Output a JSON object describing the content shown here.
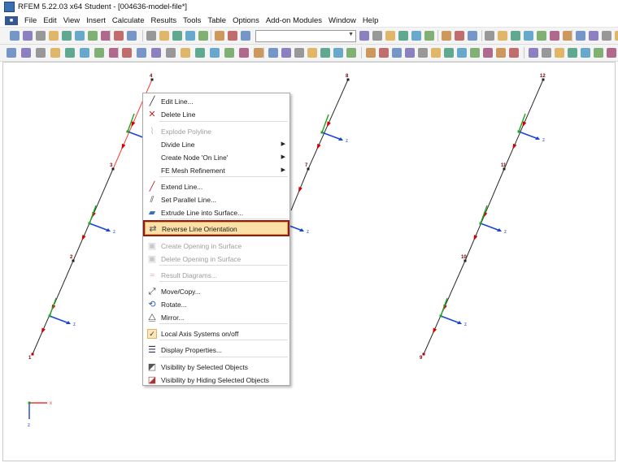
{
  "window": {
    "title": "RFEM 5.22.03 x64 Student - [004636-model-file*]"
  },
  "menu": [
    "File",
    "Edit",
    "View",
    "Insert",
    "Calculate",
    "Results",
    "Tools",
    "Table",
    "Options",
    "Add-on Modules",
    "Window",
    "Help"
  ],
  "colors": {
    "selected_line": "#ff3b30",
    "member_line": "#2a2a2a",
    "arrow": "#d00000",
    "axis_x": "#ff3030",
    "axis_y": "#1fa31f",
    "axis_z": "#1a44d8",
    "node_label": "#7a0000",
    "menu_highlight": "#fbe0a7",
    "highlight_border": "#8b1c1c"
  },
  "model": {
    "node_labels": [
      "4",
      "8",
      "12",
      "3",
      "7",
      "11",
      "2",
      "10",
      "1",
      "9"
    ],
    "axis_label_z": "z",
    "global_axes": {
      "x": "x",
      "z": "z"
    }
  },
  "context_menu": {
    "items": [
      {
        "label": "Edit Line...",
        "icon": "edit-line-icon",
        "disabled": false,
        "submenu": false
      },
      {
        "label": "Delete Line",
        "icon": "delete-line-icon",
        "disabled": false,
        "submenu": false
      },
      {
        "label": "Explode Polyline",
        "icon": "explode-polyline-icon",
        "disabled": true,
        "submenu": false
      },
      {
        "label": "Divide Line",
        "icon": "",
        "disabled": false,
        "submenu": true
      },
      {
        "label": "Create Node 'On Line'",
        "icon": "",
        "disabled": false,
        "submenu": true
      },
      {
        "label": "FE Mesh Refinement",
        "icon": "",
        "disabled": false,
        "submenu": true
      },
      {
        "label": "Extend Line...",
        "icon": "extend-line-icon",
        "disabled": false,
        "submenu": false
      },
      {
        "label": "Set Parallel Line...",
        "icon": "parallel-line-icon",
        "disabled": false,
        "submenu": false
      },
      {
        "label": "Extrude Line into Surface...",
        "icon": "extrude-icon",
        "disabled": false,
        "submenu": false
      },
      {
        "label": "Reverse Line Orientation",
        "icon": "reverse-orientation-icon",
        "disabled": false,
        "submenu": false,
        "highlighted": true
      },
      {
        "label": "Create Opening in Surface",
        "icon": "create-opening-icon",
        "disabled": true,
        "submenu": false
      },
      {
        "label": "Delete Opening in Surface",
        "icon": "delete-opening-icon",
        "disabled": true,
        "submenu": false
      },
      {
        "label": "Result Diagrams...",
        "icon": "result-diagrams-icon",
        "disabled": true,
        "submenu": false
      },
      {
        "label": "Move/Copy...",
        "icon": "move-copy-icon",
        "disabled": false,
        "submenu": false
      },
      {
        "label": "Rotate...",
        "icon": "rotate-icon",
        "disabled": false,
        "submenu": false
      },
      {
        "label": "Mirror...",
        "icon": "mirror-icon",
        "disabled": false,
        "submenu": false
      },
      {
        "label": "Local Axis Systems on/off",
        "icon": "checkmark-icon",
        "disabled": false,
        "submenu": false,
        "checked": true
      },
      {
        "label": "Display Properties...",
        "icon": "display-properties-icon",
        "disabled": false,
        "submenu": false
      },
      {
        "label": "Visibility by Selected Objects",
        "icon": "visibility-selected-icon",
        "disabled": false,
        "submenu": false
      },
      {
        "label": "Visibility by Hiding Selected Objects",
        "icon": "visibility-hiding-icon",
        "disabled": false,
        "submenu": false
      }
    ]
  }
}
